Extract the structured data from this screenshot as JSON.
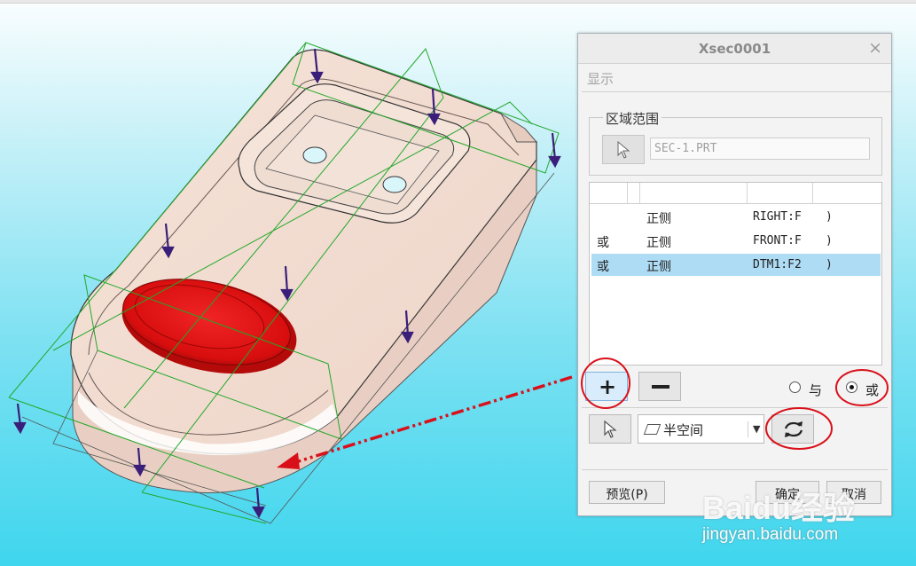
{
  "dialog": {
    "title": "Xsec0001",
    "close_glyph": "×",
    "menu_show": "显示",
    "group_label": "区域范围",
    "part_field_value": "SEC-1.PRT",
    "table_rows": [
      {
        "op": "",
        "side": "正侧",
        "plane": "RIGHT:F",
        "paren": ")",
        "selected": false
      },
      {
        "op": "或",
        "side": "正侧",
        "plane": "FRONT:F",
        "paren": ")",
        "selected": false
      },
      {
        "op": "或",
        "side": "正侧",
        "plane": "DTM1:F2",
        "paren": ")",
        "selected": true
      }
    ],
    "add_icon": "+",
    "radio_and_label": "与",
    "radio_or_label": "或",
    "radio_selected": "或",
    "half_space_label": "半空间",
    "preview_label": "预览(P)",
    "ok_label": "确定",
    "cancel_label": "取消"
  },
  "colors": {
    "selected_row": "#aedcf5",
    "annotation_red": "#d9101a",
    "part_body": "#f2ddd3",
    "red_button": "#e01010",
    "datum_plane": "#22a82a",
    "arrow": "#3a1f7a"
  },
  "icons": [
    "close-icon",
    "select-arrow-icon",
    "plus-icon",
    "minus-icon",
    "half-space-icon",
    "dropdown-icon",
    "flip-direction-icon"
  ],
  "watermark": {
    "brand": "Baidu经验",
    "url": "jingyan.baidu.com"
  }
}
